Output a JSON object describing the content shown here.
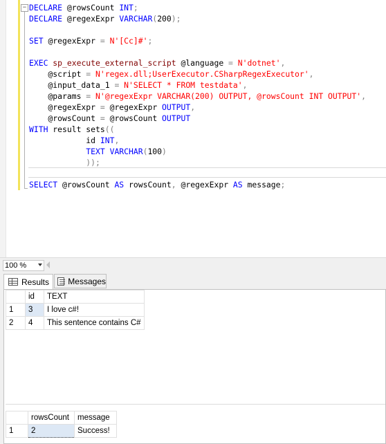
{
  "editor": {
    "collapse_symbol": "−",
    "lines": [
      [
        [
          "kw",
          "DECLARE "
        ],
        [
          "id",
          "@rowsCount "
        ],
        [
          "kw",
          "INT"
        ],
        [
          "op",
          ";"
        ]
      ],
      [
        [
          "kw",
          "DECLARE "
        ],
        [
          "id",
          "@regexExpr "
        ],
        [
          "kw",
          "VARCHAR"
        ],
        [
          "op",
          "("
        ],
        [
          "id",
          "200"
        ],
        [
          "op",
          ");"
        ]
      ],
      [],
      [
        [
          "kw",
          "SET "
        ],
        [
          "id",
          "@regexExpr "
        ],
        [
          "op",
          "= "
        ],
        [
          "str",
          "N'[Cc]#'"
        ],
        [
          "op",
          ";"
        ]
      ],
      [],
      [
        [
          "kw",
          "EXEC "
        ],
        [
          "fn",
          "sp_execute_external_script "
        ],
        [
          "id",
          "@language "
        ],
        [
          "op",
          "= "
        ],
        [
          "str",
          "N'dotnet'"
        ],
        [
          "op",
          ","
        ]
      ],
      [
        [
          "id",
          "    @script "
        ],
        [
          "op",
          "= "
        ],
        [
          "str",
          "N'regex.dll;UserExecutor.CSharpRegexExecutor'"
        ],
        [
          "op",
          ","
        ]
      ],
      [
        [
          "id",
          "    @input_data_1 "
        ],
        [
          "op",
          "= "
        ],
        [
          "str",
          "N'SELECT * FROM testdata'"
        ],
        [
          "op",
          ","
        ]
      ],
      [
        [
          "id",
          "    @params "
        ],
        [
          "op",
          "= "
        ],
        [
          "str",
          "N'@regexExpr VARCHAR(200) OUTPUT, @rowsCount INT OUTPUT'"
        ],
        [
          "op",
          ","
        ]
      ],
      [
        [
          "id",
          "    @regexExpr "
        ],
        [
          "op",
          "= "
        ],
        [
          "id",
          "@regexExpr "
        ],
        [
          "kw",
          "OUTPUT"
        ],
        [
          "op",
          ","
        ]
      ],
      [
        [
          "id",
          "    @rowsCount "
        ],
        [
          "op",
          "= "
        ],
        [
          "id",
          "@rowsCount "
        ],
        [
          "kw",
          "OUTPUT"
        ]
      ],
      [
        [
          "kw",
          "WITH "
        ],
        [
          "id",
          "result sets"
        ],
        [
          "op",
          "(("
        ]
      ],
      [
        [
          "id",
          "            id "
        ],
        [
          "kw",
          "INT"
        ],
        [
          "op",
          ","
        ]
      ],
      [
        [
          "id",
          "            "
        ],
        [
          "kw",
          "TEXT VARCHAR"
        ],
        [
          "op",
          "("
        ],
        [
          "id",
          "100"
        ],
        [
          "op",
          ")"
        ]
      ],
      [
        [
          "op",
          "            ));"
        ]
      ],
      [],
      [
        [
          "kw",
          "SELECT "
        ],
        [
          "id",
          "@rowsCount "
        ],
        [
          "kw",
          "AS "
        ],
        [
          "id",
          "rowsCount"
        ],
        [
          "op",
          ", "
        ],
        [
          "id",
          "@regexExpr "
        ],
        [
          "kw",
          "AS "
        ],
        [
          "id",
          "message"
        ],
        [
          "op",
          ";"
        ]
      ]
    ]
  },
  "zoom": {
    "value": "100 %"
  },
  "tabs": {
    "results": "Results",
    "messages": "Messages"
  },
  "grid1": {
    "columns": [
      "id",
      "TEXT"
    ],
    "rows": [
      {
        "n": "1",
        "cells": [
          "3",
          "I love c#!"
        ]
      },
      {
        "n": "2",
        "cells": [
          "4",
          "This sentence contains C#"
        ]
      }
    ]
  },
  "grid2": {
    "columns": [
      "rowsCount",
      "message"
    ],
    "rows": [
      {
        "n": "1",
        "cells": [
          "2",
          "Success!"
        ]
      }
    ]
  },
  "colors": {
    "keyword": "#0000ff",
    "function": "#800000",
    "string": "#ff0000",
    "operator": "#808080",
    "change_bar": "#f3e35a"
  }
}
